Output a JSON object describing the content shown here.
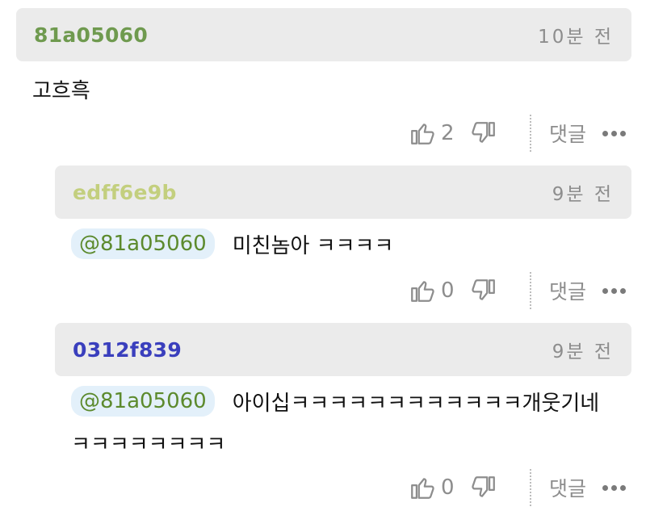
{
  "comments": [
    {
      "author": "81a05060",
      "author_color": "#6f9a4f",
      "time": "10분 전",
      "text": "고흐흑",
      "likes": "2",
      "reply_label": "댓글"
    },
    {
      "author": "edff6e9b",
      "author_color": "#c3cf7e",
      "time": "9분 전",
      "mention": "@81a05060",
      "text": "미친놈아 ㅋㅋㅋㅋ",
      "likes": "0",
      "reply_label": "댓글"
    },
    {
      "author": "0312f839",
      "author_color": "#3a3fbd",
      "time": "9분 전",
      "mention": "@81a05060",
      "text": "아이십ㅋㅋㅋㅋㅋㅋㅋㅋㅋㅋㅋㅋ개웃기네",
      "text2": "ㅋㅋㅋㅋㅋㅋㅋㅋ",
      "likes": "0",
      "reply_label": "댓글"
    }
  ],
  "icons": {
    "like": "thumbs-up-icon",
    "dislike": "thumbs-down-icon",
    "more": "more-dots-icon"
  }
}
